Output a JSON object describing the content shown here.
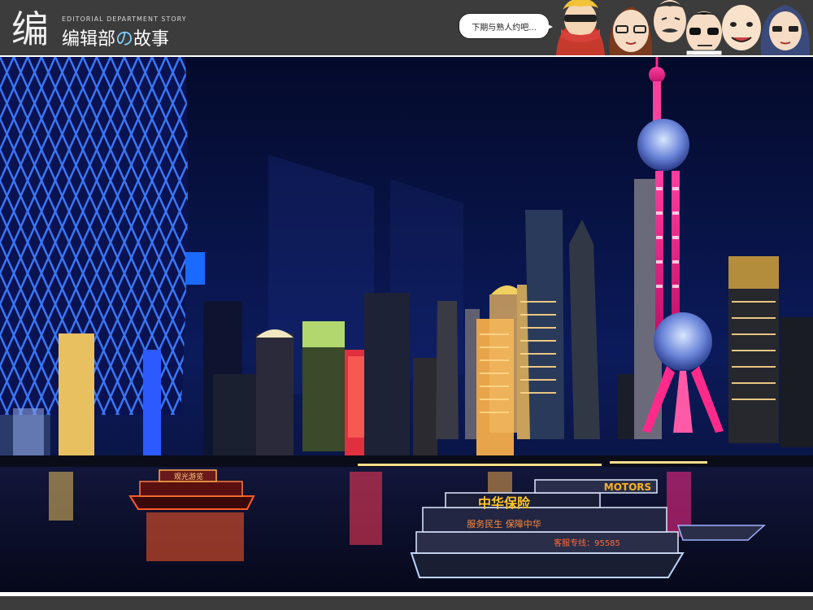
{
  "header": {
    "logo_glyph": "编",
    "logo_subtitle": "EDITORIAL DEPARTMENT STORY",
    "logo_title_a": "编辑部",
    "logo_title_b": "の",
    "logo_title_c": "故事",
    "speech_bubble": "下期与熟人约吧...",
    "avatars": [
      "masked-character",
      "woman-with-glasses",
      "man-with-moustache",
      "man-with-sunglasses",
      "bald-man",
      "woman-with-long-hair"
    ]
  },
  "photo": {
    "scene": "night skyline",
    "colors": {
      "sky": "#0b1550",
      "water": "#0c1024",
      "tower_pink": "#ff2a8a",
      "tower_sphere": "#8fb0ff",
      "building_grid": "#3b7bff",
      "boat_light": "#ff5a2a"
    },
    "boat_1": {
      "sign_top": "MOTORS",
      "sign_main": "中华保险",
      "sign_sub": "服务民生 保障中华",
      "sign_phone": "客服专线：95585"
    },
    "boat_2": {
      "sign": "观光游览"
    }
  }
}
